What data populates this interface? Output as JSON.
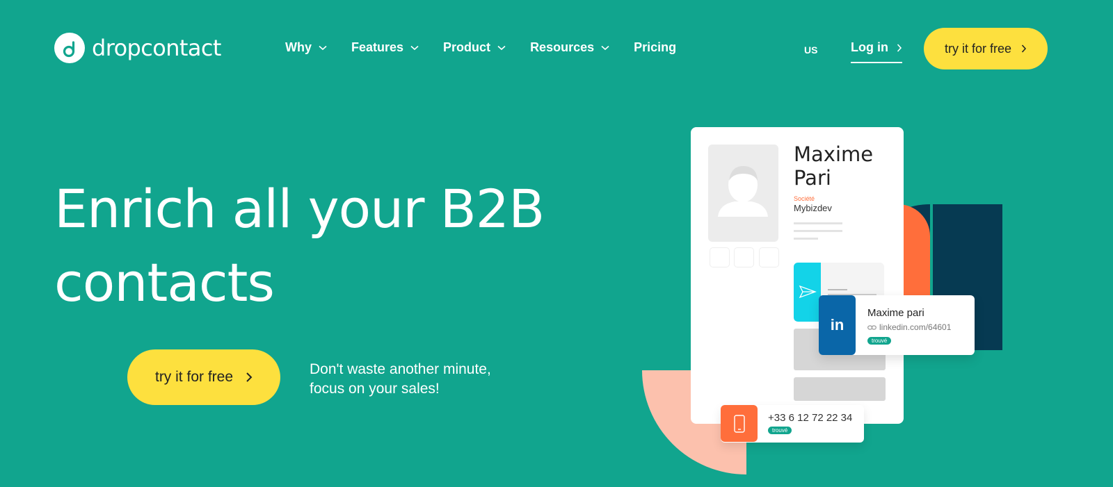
{
  "brand": {
    "name": "dropcontact"
  },
  "nav": {
    "items": [
      {
        "label": "Why",
        "has_dropdown": true
      },
      {
        "label": "Features",
        "has_dropdown": true
      },
      {
        "label": "Product",
        "has_dropdown": true
      },
      {
        "label": "Resources",
        "has_dropdown": true
      },
      {
        "label": "Pricing",
        "has_dropdown": false
      }
    ],
    "language": "US",
    "login_label": "Log in",
    "cta_label": "try it for free"
  },
  "hero": {
    "title_line1": "Enrich all your B2B",
    "title_line2": "contacts",
    "cta_label": "try it for free",
    "tagline_line1": "Don't waste another minute,",
    "tagline_line2": "focus on your sales!"
  },
  "illustration": {
    "first_name": "Maxime",
    "last_name": "Pari",
    "company_label": "Société",
    "company": "Mybizdev",
    "linkedin_name": "Maxime pari",
    "linkedin_url": "linkedin.com/64601",
    "linkedin_badge": "trouvé",
    "linkedin_logo": "in",
    "phone": "+33 6 12 72 22 34",
    "phone_badge": "trouvé"
  },
  "colors": {
    "background": "#11a58e",
    "cta": "#fde03e",
    "accent_orange": "#ff6e3b",
    "accent_navy": "#063a52",
    "accent_peach": "#fcc1ad",
    "linkedin_blue": "#0a66a8",
    "cyan": "#13d3e8"
  }
}
